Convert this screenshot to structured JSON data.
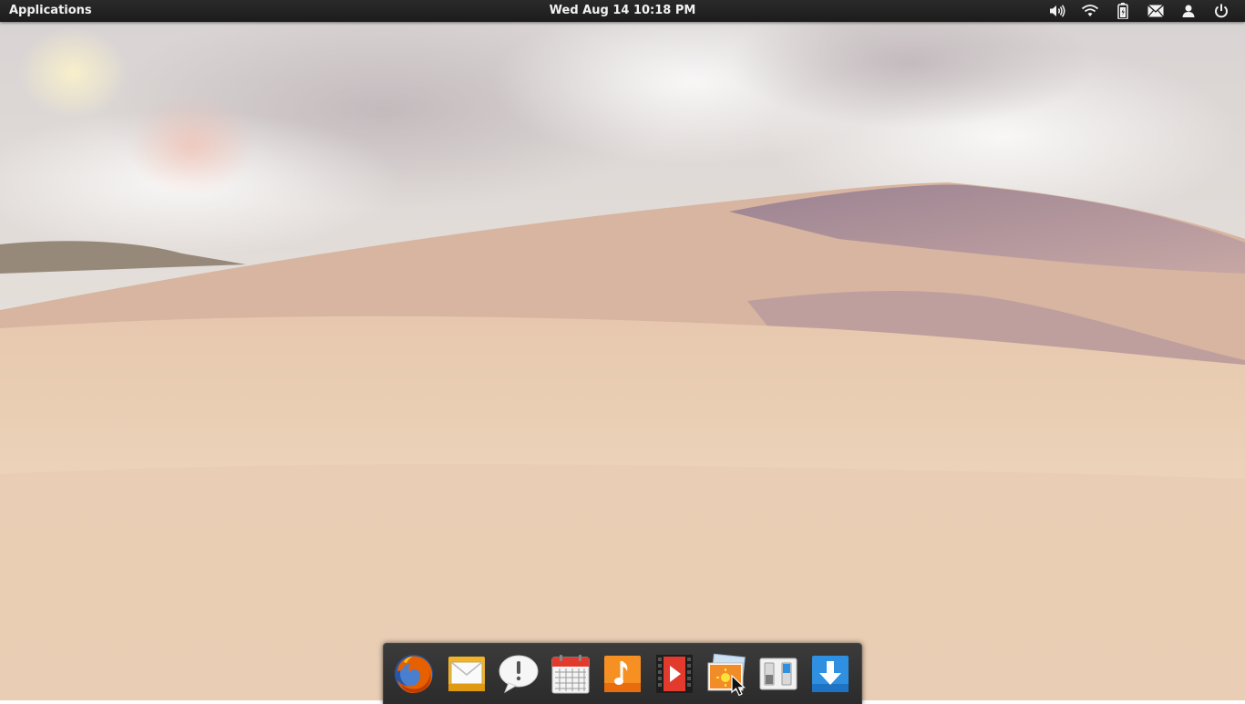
{
  "panel": {
    "applications_label": "Applications",
    "clock": "Wed Aug 14 10:18 PM",
    "indicators": [
      "volume-icon",
      "wifi-icon",
      "battery-icon",
      "mail-icon",
      "user-icon",
      "power-icon"
    ]
  },
  "dock": {
    "items": [
      {
        "icon": "firefox-icon",
        "app": "Firefox"
      },
      {
        "icon": "mail-icon",
        "app": "Mail"
      },
      {
        "icon": "chat-bubble-icon",
        "app": "Messaging"
      },
      {
        "icon": "calendar-icon",
        "app": "Calendar"
      },
      {
        "icon": "music-note-icon",
        "app": "Music"
      },
      {
        "icon": "video-icon",
        "app": "Videos"
      },
      {
        "icon": "photos-icon",
        "app": "Photos"
      },
      {
        "icon": "settings-toggle-icon",
        "app": "System Settings"
      },
      {
        "icon": "download-icon",
        "app": "Software Center"
      }
    ]
  },
  "colors": {
    "panel": "#1f1f1f",
    "dock": "#333333",
    "sand": "#e8cdb0",
    "sky": "#d9d6d6"
  }
}
